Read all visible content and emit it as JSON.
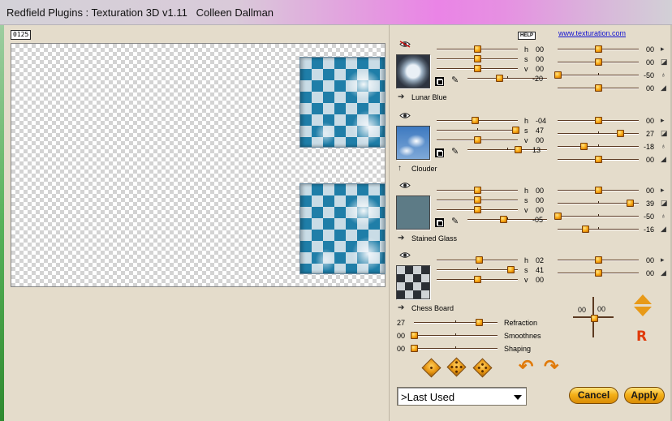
{
  "window": {
    "title": "Redfield Plugins : Texturation 3D v1.11   Colleen Dallman"
  },
  "preview": {
    "zoom": "0125"
  },
  "header": {
    "help": "HELP",
    "link": "www.texturation.com"
  },
  "layers": [
    {
      "name": "Lunar Blue",
      "visible": true,
      "eye_state": "hidden-red",
      "left": [
        {
          "label": "h",
          "value": "00",
          "level": 0.5
        },
        {
          "label": "s",
          "value": "00",
          "level": 0.5
        },
        {
          "label": "v",
          "value": "00",
          "level": 0.5
        },
        {
          "label": "",
          "value": "-20",
          "level": 0.4
        }
      ],
      "right": [
        {
          "value": "00",
          "level": 0.5
        },
        {
          "value": "00",
          "level": 0.5
        },
        {
          "value": "-50",
          "level": 0.0
        },
        {
          "value": "00",
          "level": 0.5
        }
      ]
    },
    {
      "name": "Clouder",
      "visible": true,
      "left": [
        {
          "label": "h",
          "value": "-04",
          "level": 0.47
        },
        {
          "label": "s",
          "value": "47",
          "level": 0.97
        },
        {
          "label": "v",
          "value": "00",
          "level": 0.5
        },
        {
          "label": "",
          "value": "13",
          "level": 0.63
        }
      ],
      "right": [
        {
          "value": "00",
          "level": 0.5
        },
        {
          "value": "27",
          "level": 0.77
        },
        {
          "value": "-18",
          "level": 0.32
        },
        {
          "value": "00",
          "level": 0.5
        }
      ]
    },
    {
      "name": "Stained Glass",
      "visible": true,
      "left": [
        {
          "label": "h",
          "value": "00",
          "level": 0.5
        },
        {
          "label": "s",
          "value": "00",
          "level": 0.5
        },
        {
          "label": "v",
          "value": "00",
          "level": 0.5
        },
        {
          "label": "",
          "value": "-05",
          "level": 0.45
        }
      ],
      "right": [
        {
          "value": "00",
          "level": 0.5
        },
        {
          "value": "39",
          "level": 0.89
        },
        {
          "value": "-50",
          "level": 0.0
        },
        {
          "value": "-16",
          "level": 0.34
        }
      ]
    },
    {
      "name": "Chess Board",
      "visible": true,
      "left": [
        {
          "label": "h",
          "value": "02",
          "level": 0.52
        },
        {
          "label": "s",
          "value": "41",
          "level": 0.91
        },
        {
          "label": "v",
          "value": "00",
          "level": 0.5
        }
      ],
      "right": [
        {
          "value": "00",
          "level": 0.5
        },
        {
          "value": "00",
          "level": 0.5
        }
      ]
    }
  ],
  "global": [
    {
      "label": "Refraction",
      "value": "27",
      "level": 0.78
    },
    {
      "label": "Smoothnes",
      "value": "00",
      "level": 0.0
    },
    {
      "label": "Shaping",
      "value": "00",
      "level": 0.0
    }
  ],
  "light": {
    "x": "00",
    "y": "00"
  },
  "preset": {
    "selected": ">Last Used"
  },
  "buttons": {
    "cancel": "Cancel",
    "apply": "Apply"
  },
  "colors": {
    "accent": "#f4a614",
    "link": "#1010d0",
    "panel": "#e4dccb"
  }
}
